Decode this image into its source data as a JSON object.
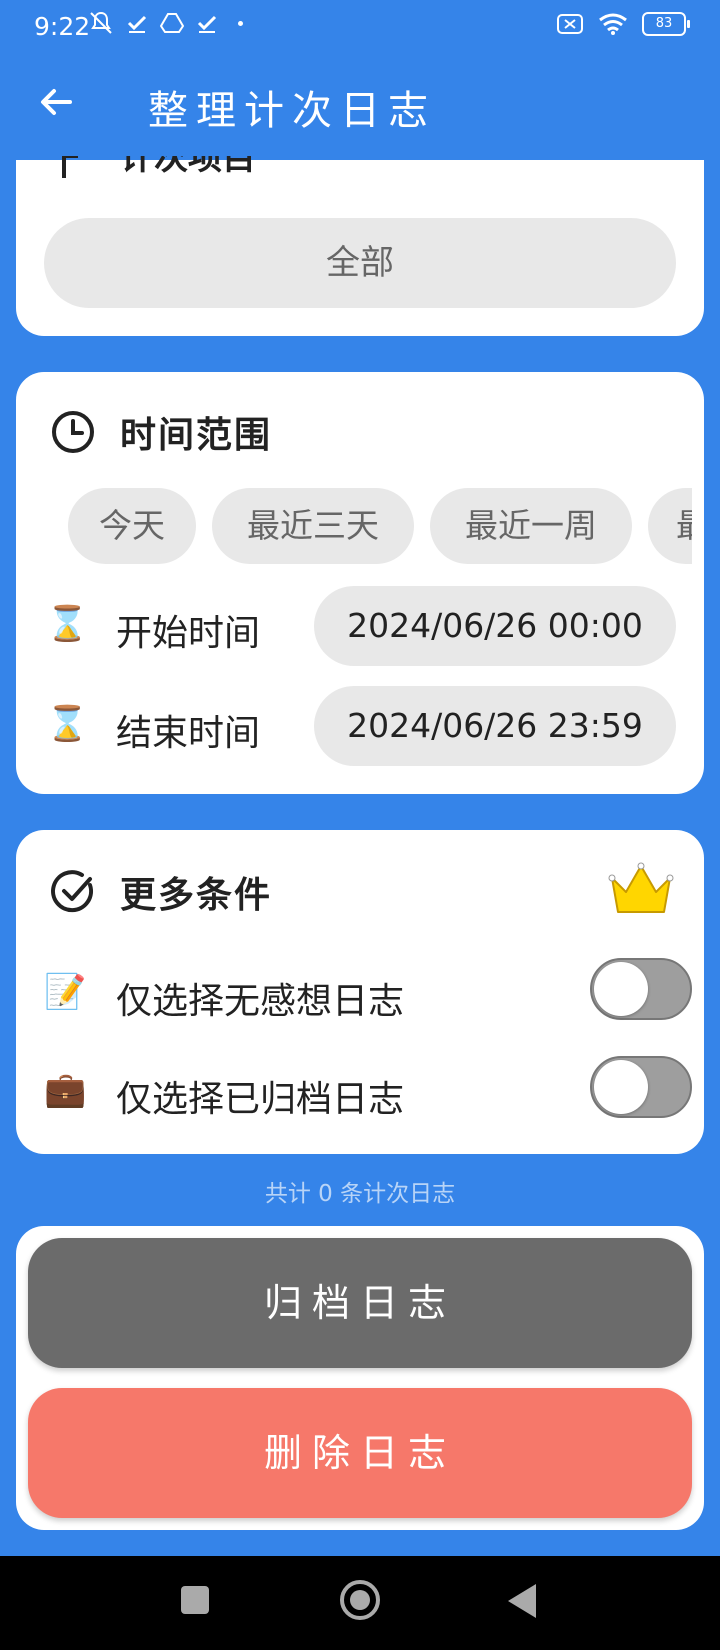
{
  "status_bar": {
    "time": "9:22",
    "battery": "83"
  },
  "app_bar": {
    "title": "整理计次日志"
  },
  "project_card": {
    "title_clipped": "计次项目",
    "selected_project": "全部"
  },
  "time_range_card": {
    "title": "时间范围",
    "chips": [
      "今天",
      "最近三天",
      "最近一周",
      "最近一月"
    ],
    "start": {
      "emoji": "⌛",
      "label": "开始时间",
      "value": "2024/06/26 00:00"
    },
    "end": {
      "emoji": "⌛",
      "label": "结束时间",
      "value": "2024/06/26 23:59"
    }
  },
  "more_conditions_card": {
    "title": "更多条件",
    "options": [
      {
        "emoji": "📝",
        "label": "仅选择无感想日志",
        "enabled": false
      },
      {
        "emoji": "💼",
        "label": "仅选择已归档日志",
        "enabled": false
      }
    ]
  },
  "summary": "共计 0 条计次日志",
  "actions": {
    "archive": "归档日志",
    "delete": "删除日志"
  },
  "colors": {
    "background": "#3584E9",
    "archive_button": "#6B6B6B",
    "delete_button": "#F6786A",
    "chip_bg": "#E8E8E8"
  }
}
